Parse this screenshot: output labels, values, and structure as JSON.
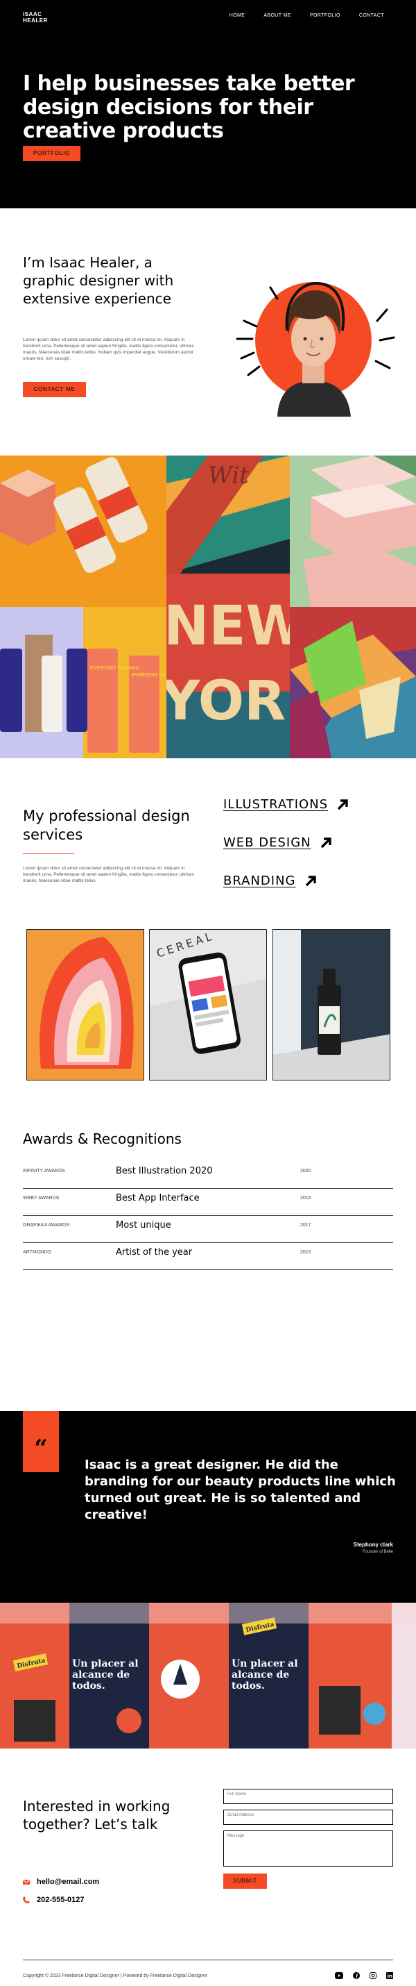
{
  "brand": {
    "name": "ISAAC\nHEALER",
    "accent": "#f44b25"
  },
  "nav": {
    "items": [
      "HOME",
      "ABOUT ME",
      "PORTFOLIO",
      "CONTACT"
    ]
  },
  "hero": {
    "headline": "I help businesses take better design decisions for their creative products",
    "cta": "PORTFOLIO"
  },
  "about": {
    "heading": "I’m Isaac Healer, a graphic designer with extensive experience",
    "body": "Lorem ipsum dolor sit amet consectetur adipiscing elit Ut et massa mi. Aliquam in hendrerit urna. Pellentesque sit amet sapien fringilla, mattis ligula consectetur, ultrices mauris. Maecenas vitae mattis tellus. Nullam quis imperdiet augue. Vestibulum auctor ornare leo, non suscipit.",
    "cta": "CONTACT ME"
  },
  "gallery": {
    "tiles": [
      "cans",
      "new-york",
      "boxes",
      "skincare",
      "abstract"
    ],
    "overlay_text": [
      "EVERYDAY HUMANS",
      "NEW",
      "YORK",
      "Wit"
    ]
  },
  "services": {
    "heading": "My professional design services",
    "body": "Lorem ipsum dolor sit amet consectetur adipiscing elit Ut et massa mi. Aliquam in hendrerit urna. Pellentesque sit amet sapien fringilla, mattis ligula consectetur, ultrices mauris. Maecenas vitae mattis tellus.",
    "links": [
      {
        "label": "ILLUSTRATIONS"
      },
      {
        "label": "WEB DESIGN"
      },
      {
        "label": "BRANDING"
      }
    ],
    "cards": [
      "illustration",
      "cereal-app",
      "bottle"
    ],
    "cereal_text": "CEREAL"
  },
  "awards": {
    "heading": "Awards & Recognitions",
    "rows": [
      {
        "org": "INFINITY AWARDS",
        "title": "Best Illustration 2020",
        "year": "2020"
      },
      {
        "org": "WEBY AWARDS",
        "title": "Best App Interface",
        "year": "2016"
      },
      {
        "org": "GRAFIKKA AWARDS",
        "title": "Most unique",
        "year": "2017"
      },
      {
        "org": "ARTMONDO",
        "title": "Artist of the year",
        "year": "2015"
      }
    ]
  },
  "testimonial": {
    "quote_mark": "“",
    "quote": "Isaac is a great designer. He did the branding for our beauty products line which turned out great. He is so talented and creative!",
    "author": "Stephony clark",
    "role": "Founder of Belle"
  },
  "banner": {
    "text_a": "Un placer al alcance de todos.",
    "text_b": "Disfruta"
  },
  "contact": {
    "heading": "Interested in working together? Let’s talk",
    "email": "hello@email.com",
    "phone": "202-555-0127",
    "fields": {
      "name": "Full Name",
      "email": "Email Address",
      "message": "Message"
    },
    "submit": "SUBMIT"
  },
  "footer": {
    "copyright": "Copyright © 2023 Freelance Digital Designer | Powered by Freelance Digital Designer",
    "socials": [
      "youtube-icon",
      "facebook-icon",
      "instagram-icon",
      "linkedin-icon"
    ]
  }
}
